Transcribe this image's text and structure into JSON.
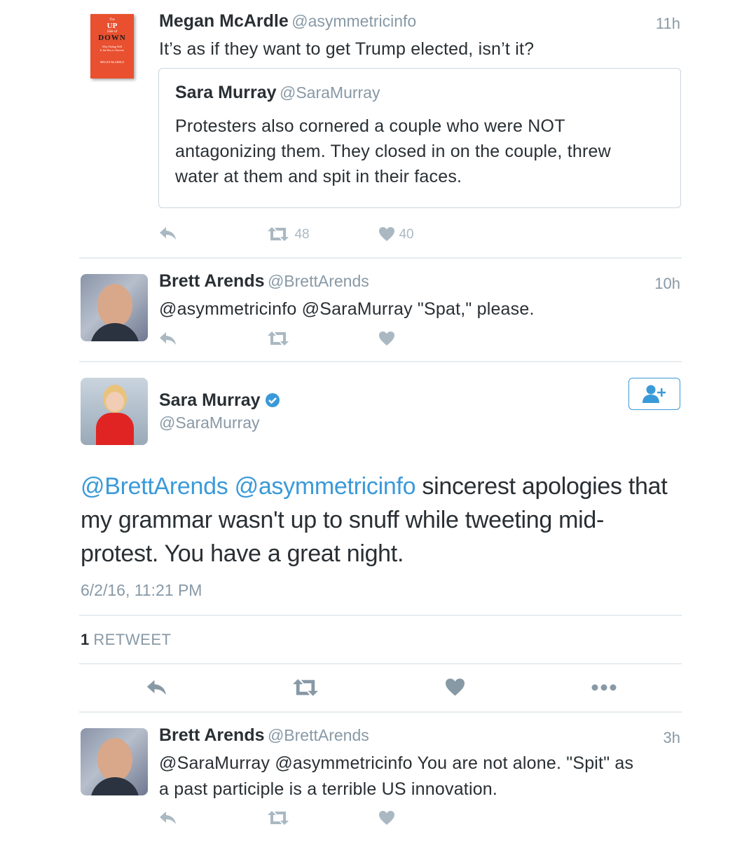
{
  "tweet1": {
    "name": "Megan McArdle",
    "handle": "@asymmetricinfo",
    "time": "11h",
    "text": "It’s as if they want to get Trump elected, isn’t it?",
    "book_cover": {
      "line1": "The",
      "line2": "UP",
      "line3": "Side of",
      "line4": "DOWN",
      "line5": "Why Failing Well",
      "line6": "Is the Key to Success",
      "line7": "MEGAN McARDLE"
    },
    "quote": {
      "name": "Sara Murray",
      "handle": "@SaraMurray",
      "text_line1": "Protesters also cornered a couple who were NOT",
      "text_line2": "antagonizing them. They closed in on the couple, threw",
      "text_line3": "water at them and spit in their faces."
    },
    "retweets": "48",
    "likes": "40"
  },
  "tweet2": {
    "name": "Brett Arends",
    "handle": "@BrettArends",
    "time": "10h",
    "text": "@asymmetricinfo @SaraMurray \"Spat,\" please."
  },
  "main_tweet": {
    "name": "Sara Murray",
    "handle": "@SaraMurray",
    "mention1": "@BrettArends",
    "mention2": "@asymmetricinfo",
    "text_after_mentions": " sincerest apologies that",
    "text_line2": "my grammar wasn't up to snuff while tweeting mid-",
    "text_line3": "protest. You have a great night.",
    "timestamp": "6/2/16, 11:21 PM",
    "retweet_count": "1",
    "retweet_label": "RETWEET"
  },
  "tweet3": {
    "name": "Brett Arends",
    "handle": "@BrettArends",
    "time": "3h",
    "text_line1": "@SaraMurray @asymmetricinfo You are not alone. \"Spit\" as",
    "text_line2": "a past participle is a terrible US innovation."
  },
  "colors": {
    "link": "#3a9ad9",
    "muted": "#8899a6",
    "icon": "#aab8c2",
    "book": "#e8502f"
  }
}
